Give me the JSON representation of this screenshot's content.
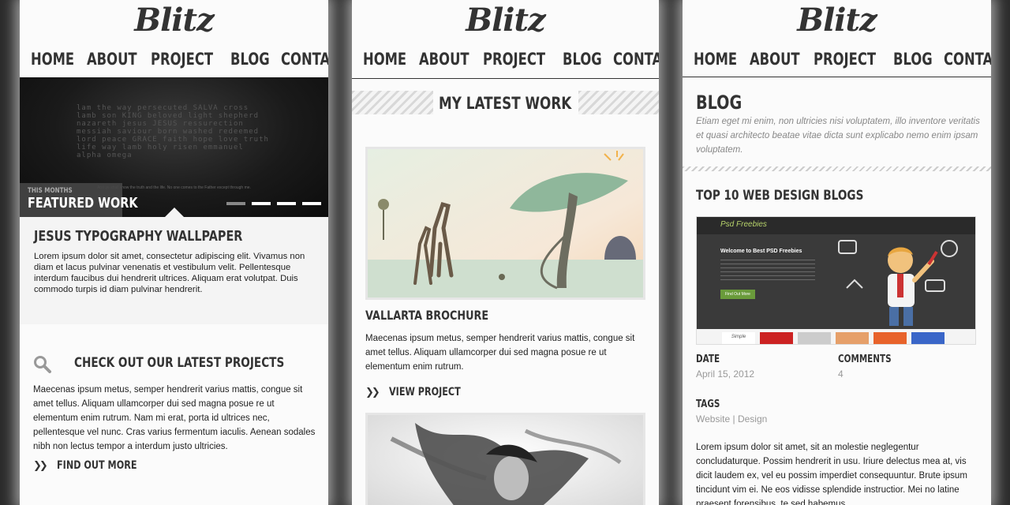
{
  "brand": "Blitz",
  "nav": [
    "HOME",
    "ABOUT",
    "PROJECT",
    "BLOG",
    "CONTACT"
  ],
  "panel1": {
    "hero_caption": "And ye shall know the truth and the life. No one comes to the Father except through me.",
    "featured_small": "THIS MONTHS",
    "featured_big": "FEATURED WORK",
    "slider_active_index": 0,
    "wallpaper_title": "JESUS TYPOGRAPHY WALLPAPER",
    "wallpaper_text": "Lorem ipsum dolor sit amet, consectetur adipiscing elit. Vivamus non diam et lacus pulvinar venenatis et vestibulum velit. Pellentesque interdum faucibus dui hendrerit ultrices. Aliquam erat volutpat. Duis commodo turpis id diam pulvinar hendrerit.",
    "projects_title": "CHECK OUT OUR LATEST PROJECTS",
    "projects_text": "Maecenas ipsum metus, semper hendrerit varius mattis, congue sit amet tellus. Aliquam ullamcorper dui sed magna posue re ut elementum enim rutrum. Nam mi erat, porta id ultrices nec, pellentesque vel nunc. Cras varius fermentum iaculis. Aenean sodales nibh non lectus tempor a interdum justo ultricies.",
    "find_out_more": "FIND OUT MORE"
  },
  "panel2": {
    "section_title": "MY LATEST WORK",
    "work_title": "VALLARTA BROCHURE",
    "work_text": "Maecenas ipsum metus, semper hendrerit varius mattis, congue sit amet tellus. Aliquam ullamcorper dui sed magna posue re ut elementum enim rutrum.",
    "view_project": "VIEW PROJECT"
  },
  "panel3": {
    "section_title": "BLOG",
    "intro": "Etiam eget mi enim, non ultricies nisi voluptatem, illo inventore veritatis et quasi architecto beatae vitae dicta sunt explicabo nemo enim ipsam voluptatem.",
    "post_title": "TOP 10 WEB DESIGN BLOGS",
    "screenshot": {
      "logo": "Psd Freebies",
      "heading": "Welcome to Best PSD Freebies",
      "button": "Find Out More",
      "thumb_label": "Simple"
    },
    "date_label": "DATE",
    "date_value": "April 15, 2012",
    "comments_label": "COMMENTS",
    "comments_value": "4",
    "tags_label": "TAGS",
    "tags": [
      "Website",
      "Design"
    ],
    "tag_separator": "|",
    "body": "Lorem ipsum dolor sit amet, sit an molestie neglegentur concludaturque. Possim hendrerit in usu. Iriure delectus mea at, vis dicit laudem ex, vel eu possim imperdiet consequuntur. Brute ipsum tincidunt vim ei. Ne eos vidisse splendide instructior. Mei no latine praesent forensibus, te sed habemus"
  }
}
